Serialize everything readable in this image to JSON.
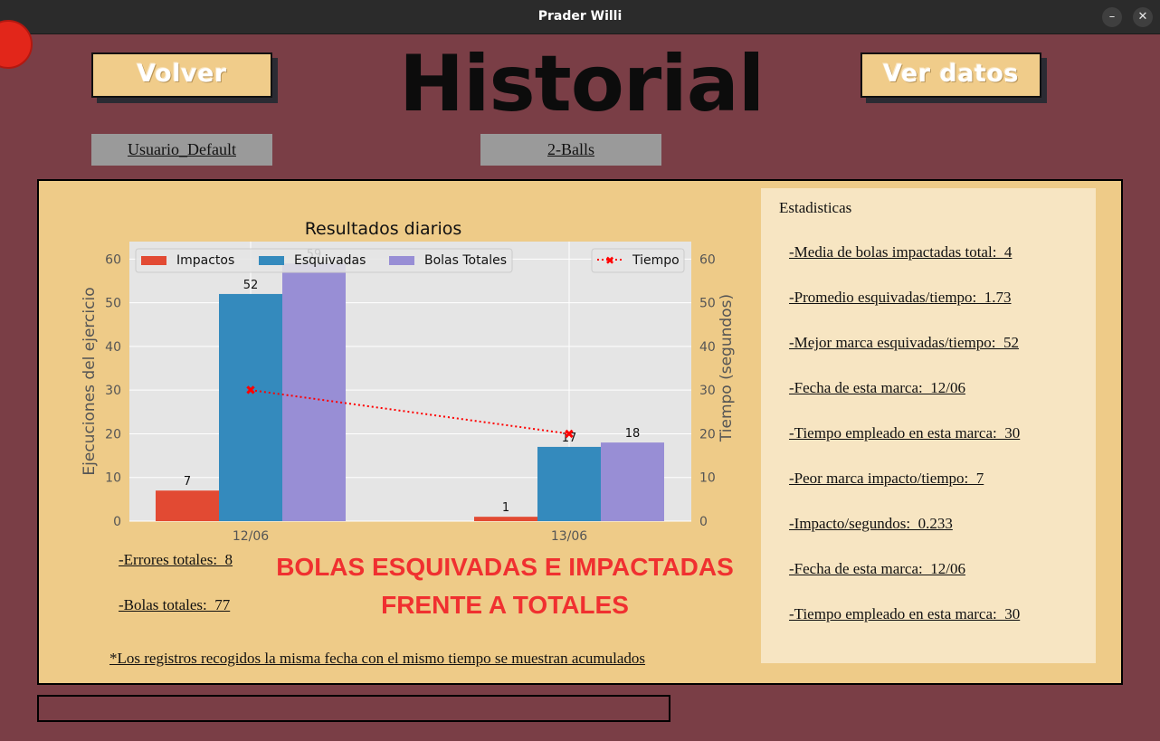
{
  "window": {
    "title": "Prader Willi"
  },
  "header": {
    "back_label": "Volver",
    "title": "Historial",
    "view_data_label": "Ver datos"
  },
  "selectors": {
    "user": "Usuario_Default",
    "game": "2-Balls"
  },
  "stats": {
    "title": "Estadisticas",
    "items": [
      "-Media de bolas impactadas total:  4",
      "-Promedio esquivadas/tiempo:  1.73",
      "-Mejor marca esquivadas/tiempo:  52",
      "-Fecha de esta marca:  12/06",
      "-Tiempo empleado en esta marca:  30",
      "-Peor marca impacto/tiempo:  7",
      "-Impacto/segundos:  0.233",
      "-Fecha de esta marca:  12/06",
      "-Tiempo empleado en esta marca:  30"
    ]
  },
  "summary": {
    "errors": "-Errores totales:  8",
    "total_balls": "-Bolas totales:  77",
    "headline_line1": "BOLAS ESQUIVADAS  E IMPACTADAS",
    "headline_line2": "FRENTE A TOTALES",
    "footnote": "*Los registros recogidos la misma fecha con el mismo tiempo se muestran acumulados"
  },
  "colors": {
    "background": "#7a3e46",
    "panel": "#eecb88",
    "stats_panel": "#f7e5c2",
    "button": "#f0cc8a",
    "headline": "#f03030"
  },
  "chart_data": {
    "type": "bar",
    "title": "Resultados diarios",
    "categories": [
      "12/06",
      "13/06"
    ],
    "series": [
      {
        "name": "Impactos",
        "values": [
          7,
          1
        ],
        "color": "#e24a33"
      },
      {
        "name": "Esquivadas",
        "values": [
          52,
          17
        ],
        "color": "#348abd"
      },
      {
        "name": "Bolas Totales",
        "values": [
          59,
          18
        ],
        "color": "#988ed5"
      }
    ],
    "secondary": {
      "name": "Tiempo",
      "type": "line",
      "values": [
        30,
        20
      ],
      "color": "#ff0000"
    },
    "ylabel": "Ejecuciones del ejercicio",
    "y2label": "Tiempo (segundos)",
    "ylim": [
      0,
      64
    ],
    "y2lim": [
      0,
      64
    ],
    "yticks": [
      0,
      10,
      20,
      30,
      40,
      50,
      60
    ],
    "grid": true,
    "legend": "top-left",
    "legend2": "top-right"
  }
}
